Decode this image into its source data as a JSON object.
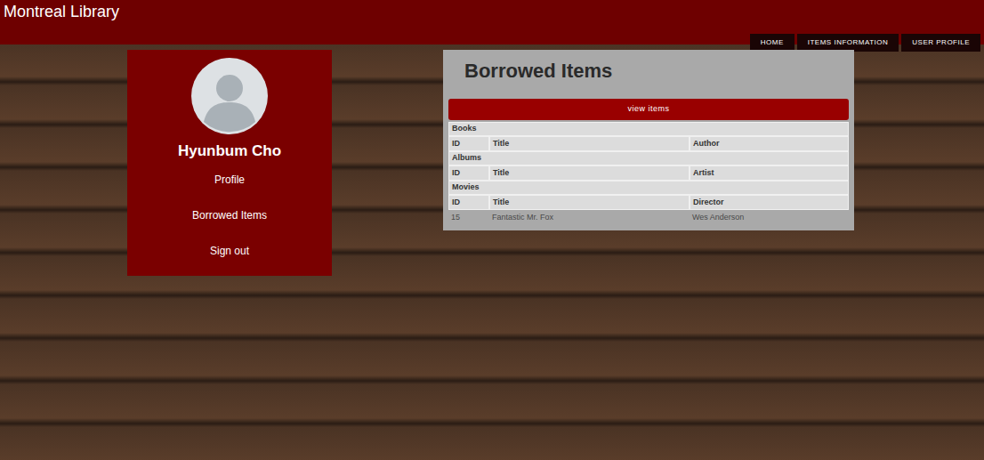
{
  "header": {
    "title": "Montreal Library"
  },
  "nav": [
    {
      "label": "HOME"
    },
    {
      "label": "ITEMS INFORMATION"
    },
    {
      "label": "USER PROFILE"
    }
  ],
  "profile": {
    "name": "Hyunbum Cho",
    "menu": [
      {
        "label": "Profile"
      },
      {
        "label": "Borrowed Items"
      },
      {
        "label": "Sign out"
      }
    ]
  },
  "panel": {
    "title": "Borrowed Items",
    "button": "view items",
    "sections": [
      {
        "name": "Books",
        "columns": [
          "ID",
          "Title",
          "Author"
        ],
        "rows": []
      },
      {
        "name": "Albums",
        "columns": [
          "ID",
          "Title",
          "Artist"
        ],
        "rows": []
      },
      {
        "name": "Movies",
        "columns": [
          "ID",
          "Title",
          "Director"
        ],
        "rows": [
          [
            "15",
            "Fantastic Mr. Fox",
            "Wes Anderson"
          ]
        ]
      }
    ]
  }
}
